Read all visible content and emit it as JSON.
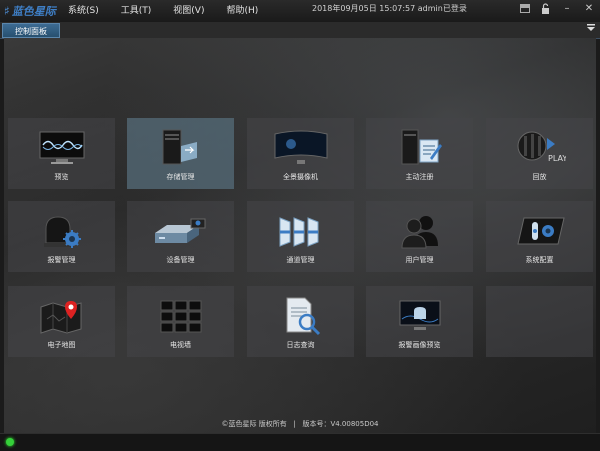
{
  "app": {
    "logo_text": "蓝色星际",
    "logo_icon": "brand-mark-icon"
  },
  "menu": [
    {
      "label": "系统(S)"
    },
    {
      "label": "工具(T)"
    },
    {
      "label": "视图(V)"
    },
    {
      "label": "帮助(H)"
    }
  ],
  "status": {
    "datetime": "2018年09月05日 15:07:57",
    "user_text": "admin已登录"
  },
  "tabs": [
    {
      "label": "控制面板",
      "active": true
    }
  ],
  "tiles": [
    {
      "label": "预览",
      "icon": "monitor-wave-icon",
      "selected": false
    },
    {
      "label": "存储管理",
      "icon": "server-archive-icon",
      "selected": true
    },
    {
      "label": "全景摄像机",
      "icon": "panoramic-display-icon",
      "selected": false
    },
    {
      "label": "主动注册",
      "icon": "server-register-icon",
      "selected": false
    },
    {
      "label": "回放",
      "icon": "film-play-icon",
      "selected": false
    },
    {
      "label": "报警管理",
      "icon": "alarm-gear-icon",
      "selected": false
    },
    {
      "label": "设备管理",
      "icon": "device-camera-icon",
      "selected": false
    },
    {
      "label": "通道管理",
      "icon": "channel-panels-icon",
      "selected": false
    },
    {
      "label": "用户管理",
      "icon": "users-icon",
      "selected": false
    },
    {
      "label": "系统配置",
      "icon": "system-config-icon",
      "selected": false
    },
    {
      "label": "电子地图",
      "icon": "map-pin-icon",
      "selected": false
    },
    {
      "label": "电视墙",
      "icon": "tv-wall-icon",
      "selected": false
    },
    {
      "label": "日志查询",
      "icon": "log-search-icon",
      "selected": false
    },
    {
      "label": "报警画像预览",
      "icon": "alarm-preview-icon",
      "selected": false
    },
    {
      "label": "",
      "icon": "",
      "selected": false
    }
  ],
  "footer": {
    "copyright": "©蓝色星际 版权所有",
    "separator": "|",
    "version": "版本号：V4.00805D04"
  },
  "bottom": {
    "status_led_color": "#35d13a"
  }
}
